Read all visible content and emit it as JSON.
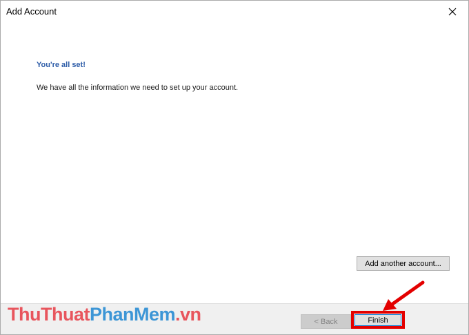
{
  "window": {
    "title": "Add Account",
    "close_symbol": "✕"
  },
  "content": {
    "heading": "You're all set!",
    "info": "We have all the information we need to set up your account.",
    "add_another_label": "Add another account..."
  },
  "footer": {
    "back_label": "< Back",
    "finish_label": "Finish"
  },
  "watermark": {
    "part1": "ThuThuat",
    "part2": "PhanMem",
    "part3": ".vn"
  },
  "colors": {
    "heading": "#2e5da8",
    "highlight": "#e30000",
    "watermark_red": "#e8555d",
    "watermark_blue": "#3d96d6"
  },
  "icons": {
    "close": "close-icon",
    "arrow": "red-arrow-icon"
  }
}
